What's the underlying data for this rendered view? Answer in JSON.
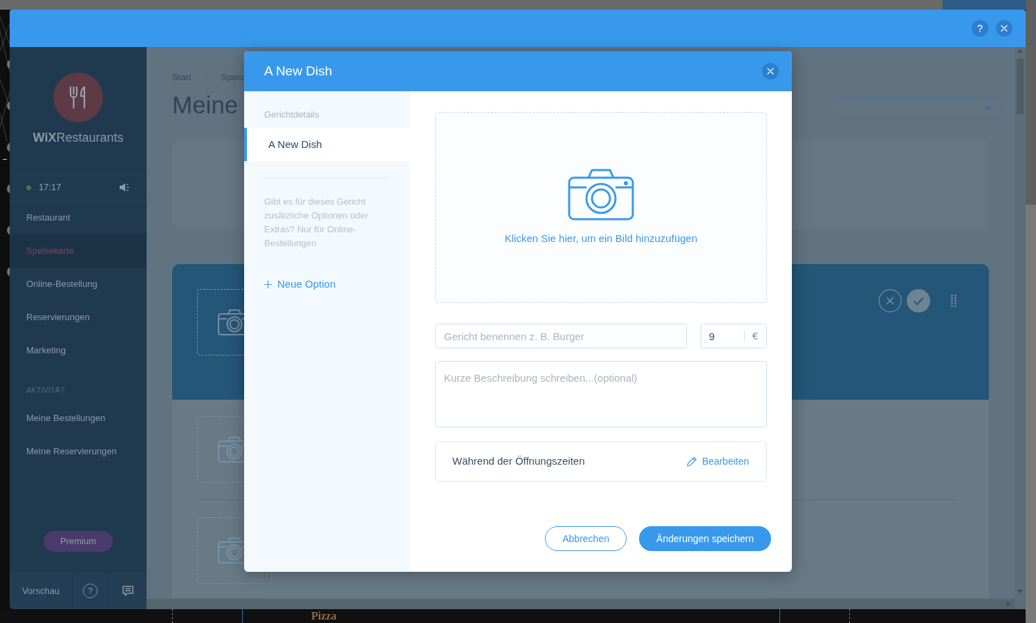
{
  "panel": {
    "help_button": "?"
  },
  "sidebar": {
    "logo": "**WiX**Restaurants",
    "clock": "17:17",
    "items": [
      {
        "label": "Restaurant",
        "selected": false
      },
      {
        "label": "Speisekarte",
        "selected": true
      },
      {
        "label": "Online-Bestellung",
        "selected": false
      },
      {
        "label": "Reservierungen",
        "selected": false
      },
      {
        "label": "Marketing",
        "selected": false
      }
    ],
    "section_label": "AKTIVITÄT",
    "activity_items": [
      {
        "label": "Meine Bestellungen",
        "selected": false
      },
      {
        "label": "Meine Reservierungen",
        "selected": false
      }
    ],
    "premium_button": "Premium",
    "footer": {
      "preview_button": "Vorschau",
      "help_button": "?"
    }
  },
  "page": {
    "breadcrumb": [
      "Start",
      "Speis"
    ],
    "title": "Meine"
  },
  "dialog": {
    "title": "A New Dish",
    "nav": {
      "section_label": "Gerichtdetails",
      "items": [
        {
          "label": "A New Dish",
          "selected": true
        }
      ],
      "hint": "Gibt es für dieses Gericht zusätzliche Optionen oder Extras? Nur für Online-Bestellungen",
      "add_option": "Neue Option"
    },
    "image_upload": "Klicken Sie hier, um ein Bild hinzuzufügen",
    "name_field": {
      "placeholder": "Gericht benennen z. B. Burger"
    },
    "price_field": {
      "value": "9",
      "currency": "€"
    },
    "description_field": {
      "placeholder": "Kurze Beschreibung schreiben...(optional)"
    },
    "availability": {
      "text": "Während der Öffnungszeiten",
      "edit_link": "Bearbeiten"
    },
    "buttons": [
      {
        "label": "Abbrechen",
        "kind": "secondary"
      },
      {
        "label": "Änderungen speichern",
        "kind": "primary"
      }
    ]
  },
  "editor_canvas": {
    "heading": "Pizza"
  }
}
